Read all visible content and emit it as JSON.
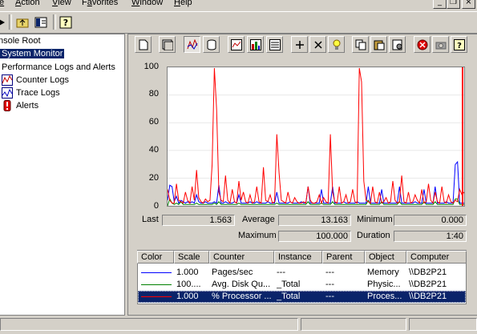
{
  "menu": {
    "items": [
      {
        "pre": "",
        "u": "e",
        "post": ""
      },
      {
        "pre": "",
        "u": "A",
        "post": "ction"
      },
      {
        "pre": "",
        "u": "V",
        "post": "iew"
      },
      {
        "pre": "F",
        "u": "a",
        "post": "vorites"
      },
      {
        "pre": "",
        "u": "W",
        "post": "indow"
      },
      {
        "pre": "",
        "u": "H",
        "post": "elp"
      }
    ]
  },
  "tree": {
    "root": "nsole Root",
    "system_monitor": "System Monitor",
    "perf_logs": "Performance Logs and Alerts",
    "counter_logs": "Counter Logs",
    "trace_logs": "Trace Logs",
    "alerts": "Alerts"
  },
  "graph": {
    "y_ticks": [
      "100",
      "80",
      "60",
      "40",
      "20",
      "0"
    ]
  },
  "values": {
    "last_label": "Last",
    "last": "1.563",
    "average_label": "Average",
    "average": "13.163",
    "minimum_label": "Minimum",
    "minimum": "0.000",
    "maximum_label": "Maximum",
    "maximum": "100.000",
    "duration_label": "Duration",
    "duration": "1:40"
  },
  "table": {
    "headers": [
      "Color",
      "Scale",
      "Counter",
      "Instance",
      "Parent",
      "Object",
      "Computer"
    ],
    "rows": [
      {
        "scale": "1.000",
        "counter": "Pages/sec",
        "instance": "---",
        "parent": "---",
        "object": "Memory",
        "computer": "\\\\DB2P21"
      },
      {
        "scale": "100....",
        "counter": "Avg. Disk Qu...",
        "instance": "_Total",
        "parent": "---",
        "object": "Physic...",
        "computer": "\\\\DB2P21"
      },
      {
        "scale": "1.000",
        "counter": "% Processor ...",
        "instance": "_Total",
        "parent": "---",
        "object": "Proces...",
        "computer": "\\\\DB2P21"
      }
    ]
  },
  "colors": {
    "series_memory": "#0000ff",
    "series_disk": "#008000",
    "series_processor": "#ff0000",
    "selection": "#0a246a",
    "time_bar": "#ff0000"
  },
  "chart_data": {
    "type": "line",
    "ylim": [
      0,
      100
    ],
    "series": [
      {
        "name": "Pages/sec",
        "values": [
          4,
          15,
          14,
          3,
          7,
          2,
          4,
          3,
          2,
          3,
          2,
          3,
          2,
          8,
          3,
          2,
          2,
          3,
          2,
          2,
          2,
          3,
          2,
          15,
          2,
          2,
          3,
          2,
          2,
          2,
          3,
          2,
          8,
          2,
          2,
          2,
          2,
          3,
          2,
          2,
          3,
          2,
          2,
          2,
          2,
          3,
          2,
          2,
          2,
          10,
          2,
          2,
          2,
          2,
          2,
          3,
          2,
          2,
          2,
          2,
          3,
          2,
          2,
          14,
          2,
          2,
          2,
          2,
          2,
          12,
          2,
          2,
          2,
          2,
          14,
          2,
          2,
          2,
          2,
          3,
          2,
          2,
          2,
          2,
          2,
          3,
          2,
          2,
          2,
          2,
          14,
          2,
          2,
          2,
          2,
          2,
          12,
          2,
          2,
          2,
          2,
          2,
          2,
          2,
          14,
          2,
          2,
          2,
          2,
          2,
          2,
          3,
          2,
          2,
          2,
          12,
          2,
          2,
          2,
          2,
          14,
          2,
          2,
          2,
          2,
          3,
          2,
          2,
          2,
          30,
          32,
          2,
          2,
          2
        ]
      },
      {
        "name": "Avg. Disk Queue Length",
        "values": [
          0,
          5,
          2,
          1,
          2,
          1,
          3,
          1,
          1,
          1,
          1,
          1,
          1,
          2,
          1,
          1,
          1,
          1,
          1,
          1,
          1,
          2,
          1,
          3,
          1,
          1,
          1,
          1,
          1,
          1,
          1,
          1,
          2,
          1,
          1,
          1,
          1,
          1,
          1,
          1,
          1,
          1,
          1,
          1,
          1,
          1,
          1,
          1,
          1,
          2,
          1,
          1,
          1,
          1,
          1,
          1,
          1,
          1,
          1,
          1,
          1,
          1,
          1,
          3,
          1,
          1,
          1,
          1,
          1,
          2,
          1,
          1,
          1,
          1,
          3,
          1,
          1,
          1,
          1,
          1,
          1,
          1,
          1,
          1,
          1,
          1,
          1,
          1,
          1,
          1,
          4,
          1,
          1,
          1,
          1,
          1,
          3,
          1,
          1,
          1,
          1,
          1,
          1,
          1,
          3,
          1,
          1,
          1,
          1,
          1,
          1,
          1,
          1,
          1,
          1,
          3,
          1,
          1,
          1,
          1,
          3,
          1,
          1,
          1,
          1,
          1,
          1,
          1,
          1,
          5,
          5,
          1,
          1,
          1
        ]
      },
      {
        "name": "% Processor Time",
        "values": [
          12,
          4,
          2,
          2,
          16,
          4,
          3,
          2,
          10,
          4,
          2,
          14,
          4,
          26,
          6,
          3,
          2,
          5,
          3,
          4,
          30,
          100,
          70,
          10,
          4,
          3,
          22,
          4,
          2,
          12,
          3,
          2,
          18,
          4,
          10,
          3,
          2,
          8,
          2,
          3,
          14,
          3,
          2,
          28,
          4,
          3,
          8,
          2,
          3,
          52,
          24,
          4,
          3,
          2,
          10,
          3,
          2,
          6,
          3,
          2,
          2,
          3,
          2,
          14,
          4,
          2,
          2,
          3,
          8,
          2,
          6,
          3,
          2,
          52,
          10,
          3,
          2,
          14,
          2,
          3,
          8,
          2,
          3,
          12,
          3,
          2,
          100,
          90,
          18,
          4,
          3,
          2,
          14,
          3,
          2,
          10,
          2,
          3,
          6,
          2,
          3,
          18,
          4,
          2,
          3,
          22,
          3,
          2,
          10,
          2,
          3,
          8,
          4,
          2,
          12,
          2,
          3,
          16,
          4,
          2,
          10,
          3,
          2,
          14,
          3,
          2,
          8,
          3,
          2,
          4,
          3,
          12,
          8,
          10
        ]
      }
    ]
  }
}
